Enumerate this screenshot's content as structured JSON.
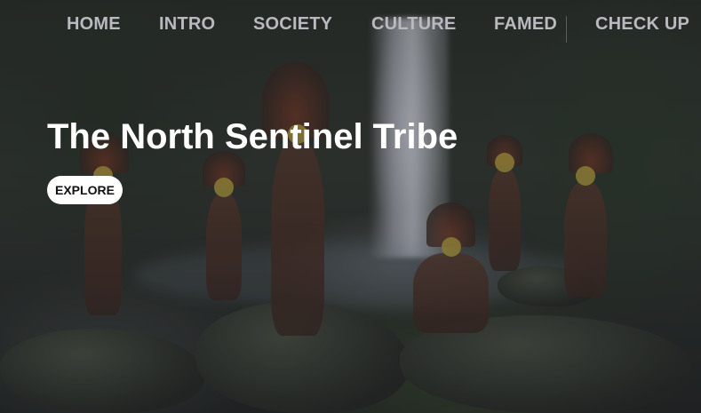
{
  "nav": {
    "items": [
      {
        "label": "HOME"
      },
      {
        "label": "INTRO"
      },
      {
        "label": "SOCIETY"
      },
      {
        "label": "CULTURE"
      },
      {
        "label": "FAMED"
      },
      {
        "label": "CHECK UP"
      }
    ]
  },
  "hero": {
    "title": "The North Sentinel Tribe",
    "cta_label": "EXPLORE",
    "background_image": "tribe-by-waterfall-photo"
  },
  "colors": {
    "nav_text": "#b9bac0",
    "title_text": "#ffffff",
    "button_bg": "#ffffff",
    "button_text": "#111111"
  }
}
